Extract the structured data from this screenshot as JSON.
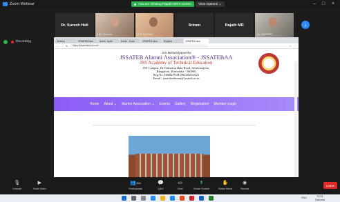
{
  "zoom": {
    "window_title": "Zoom Webinar",
    "share_banner": "You are viewing Rajath MR's screen",
    "view_options": "View Options",
    "recording_label": "Recording"
  },
  "participants": [
    {
      "name": "Dr. Suresh Holi",
      "caption": ""
    },
    {
      "name": "",
      "caption": "MS. Girinara"
    },
    {
      "name": "",
      "caption": "D.R. BYHMA"
    },
    {
      "name": "Sriram",
      "caption": ""
    },
    {
      "name": "Rajath MR",
      "caption": ""
    },
    {
      "name": "",
      "caption": "Dr. SURESH"
    }
  ],
  "browser": {
    "tabs": [
      "Webinar",
      "JSSATEB Alum",
      "Admis. Syste",
      "Admin - Socie",
      "JSSATEB Alum",
      "Registra",
      "JSSATEB Alum"
    ],
    "url": "https://jssatebalumni.com"
  },
  "site": {
    "line1": "JSS Mahavidyapeetha",
    "title": "JSSATEB Alumni Association® - JSSATEBAA",
    "subtitle": "JSS Academy of Technical Education",
    "address1": "JSS Campus, Dr.Vishnuvardhan Road, Srinivasapura,",
    "address2": "Bengaluru, Karnataka - 560060",
    "reg": "Reg No: DRB4/SOR/298/2020-2021",
    "email": "Email : jssatebaalumni@jssateb.ac.in",
    "nav": [
      "Home",
      "About ⌄",
      "Alumni Association ⌄",
      "Events",
      "Gallery",
      "Registration",
      "Member-Login"
    ]
  },
  "toolbar": {
    "unmute": "Unmute",
    "start_video": "Start Video",
    "participants_count": "266",
    "participants": "Participants",
    "qa": "Q&A",
    "chat": "Chat",
    "share_screen": "Share Screen",
    "raise_hand": "Raise Hand",
    "record": "Record",
    "leave": "Leave"
  },
  "taskbar": {
    "lang": "ENG",
    "time": "12:09",
    "date": "Saturday"
  }
}
